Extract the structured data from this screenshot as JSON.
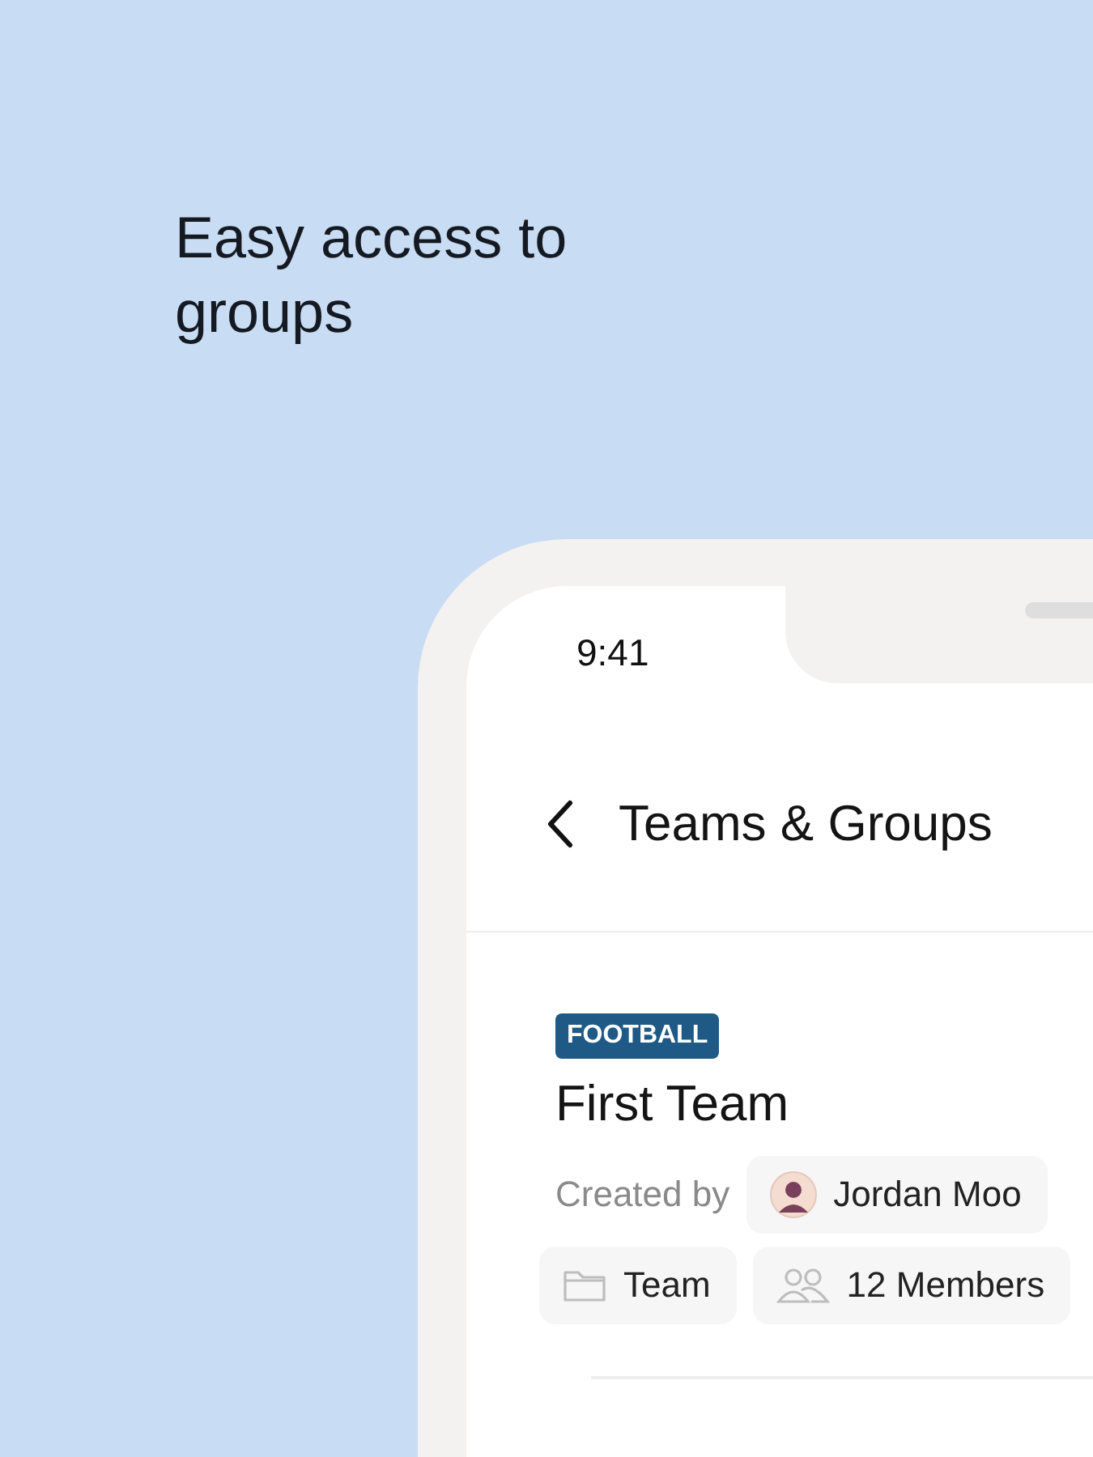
{
  "headline": "Easy access to groups",
  "status_bar": {
    "time": "9:41"
  },
  "header": {
    "title": "Teams & Groups"
  },
  "group": {
    "tag": "FOOTBALL",
    "name": "First Team",
    "created_by_label": "Created by",
    "creator": "Jordan Moo",
    "type": "Team",
    "members": "12 Members"
  }
}
